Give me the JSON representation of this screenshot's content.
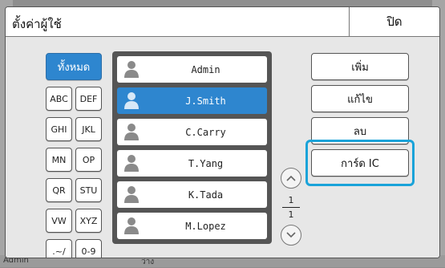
{
  "background": {
    "user_label": "Admin",
    "status_text": "ว่าง"
  },
  "dialog": {
    "title": "ตั้งค่าผู้ใช้",
    "close_label": "ปิด"
  },
  "index_buttons": {
    "all": "ทั้งหมด",
    "abc": "ABC",
    "def": "DEF",
    "ghi": "GHI",
    "jkl": "JKL",
    "mn": "MN",
    "op": "OP",
    "qr": "QR",
    "stu": "STU",
    "vw": "VW",
    "xyz": "XYZ",
    "symbols": ".~/",
    "digits": "0-9"
  },
  "users": [
    {
      "name": "Admin",
      "selected": false
    },
    {
      "name": "J.Smith",
      "selected": true
    },
    {
      "name": "C.Carry",
      "selected": false
    },
    {
      "name": "T.Yang",
      "selected": false
    },
    {
      "name": "K.Tada",
      "selected": false
    },
    {
      "name": "M.Lopez",
      "selected": false
    }
  ],
  "pager": {
    "current": "1",
    "total": "1"
  },
  "actions": {
    "add": "เพิ่ม",
    "edit": "แก้ไข",
    "delete": "ลบ",
    "ic_card": "การ์ด IC"
  },
  "colors": {
    "accent": "#2e86cf",
    "highlight": "#1aa3d9"
  }
}
